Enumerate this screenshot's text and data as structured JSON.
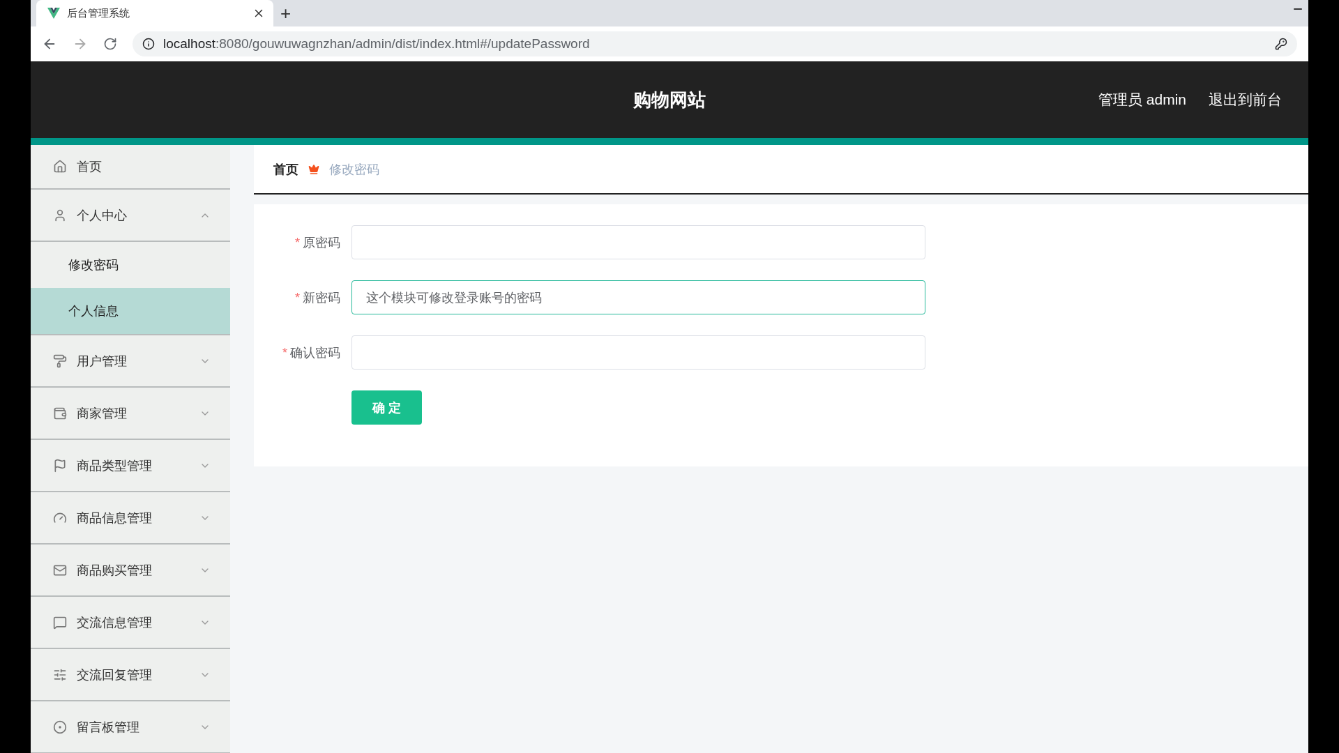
{
  "browser": {
    "tab_title": "后台管理系统",
    "new_tab": "+",
    "url_host": "localhost",
    "url_rest": ":8080/gouwuwagnzhan/admin/dist/index.html#/updatePassword"
  },
  "header": {
    "title": "购物网站",
    "user": "管理员 admin",
    "logout": "退出到前台"
  },
  "sidebar": {
    "items": [
      {
        "kind": "link",
        "label": "首页"
      },
      {
        "kind": "menu",
        "label": "个人中心",
        "expanded": true,
        "children": [
          {
            "label": "修改密码",
            "selected": false
          },
          {
            "label": "个人信息",
            "selected": true
          }
        ]
      },
      {
        "kind": "menu",
        "label": "用户管理",
        "expanded": false
      },
      {
        "kind": "menu",
        "label": "商家管理",
        "expanded": false
      },
      {
        "kind": "menu",
        "label": "商品类型管理",
        "expanded": false
      },
      {
        "kind": "menu",
        "label": "商品信息管理",
        "expanded": false
      },
      {
        "kind": "menu",
        "label": "商品购买管理",
        "expanded": false
      },
      {
        "kind": "menu",
        "label": "交流信息管理",
        "expanded": false
      },
      {
        "kind": "menu",
        "label": "交流回复管理",
        "expanded": false
      },
      {
        "kind": "menu",
        "label": "留言板管理",
        "expanded": false
      }
    ]
  },
  "breadcrumb": {
    "home": "首页",
    "current": "修改密码"
  },
  "form": {
    "fields": [
      {
        "label": "原密码",
        "required": true,
        "focused": false
      },
      {
        "label": "新密码",
        "required": true,
        "focused": true,
        "value": "这个模块可修改登录账号的密码"
      },
      {
        "label": "确认密码",
        "required": true,
        "focused": false
      }
    ],
    "required_mark": "*",
    "submit": "确 定"
  }
}
